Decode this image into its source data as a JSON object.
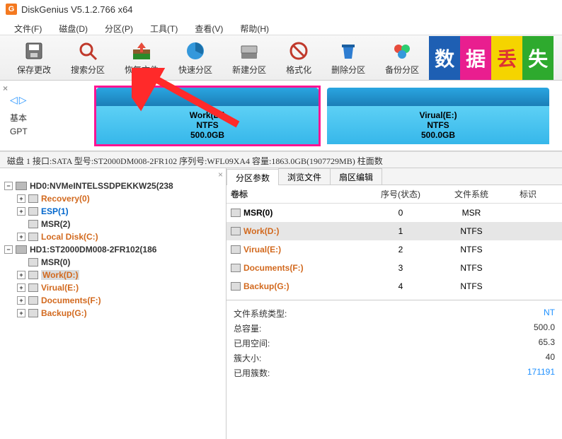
{
  "title": "DiskGenius V5.1.2.766 x64",
  "menu": [
    "文件(F)",
    "磁盘(D)",
    "分区(P)",
    "工具(T)",
    "查看(V)",
    "帮助(H)"
  ],
  "toolbar": [
    {
      "label": "保存更改",
      "icon": "save-icon"
    },
    {
      "label": "搜索分区",
      "icon": "search-icon"
    },
    {
      "label": "恢复文件",
      "icon": "recover-icon"
    },
    {
      "label": "快速分区",
      "icon": "quick-part-icon"
    },
    {
      "label": "新建分区",
      "icon": "new-part-icon"
    },
    {
      "label": "格式化",
      "icon": "format-icon"
    },
    {
      "label": "删除分区",
      "icon": "delete-part-icon"
    },
    {
      "label": "备份分区",
      "icon": "backup-icon"
    }
  ],
  "logo_chars": [
    {
      "ch": "数",
      "bg": "#1e5fb3"
    },
    {
      "ch": "据",
      "bg": "#e91e8f"
    },
    {
      "ch": "丢",
      "bg": "#f5d400",
      "fg": "#d33"
    },
    {
      "ch": "失",
      "bg": "#2eaa2e"
    }
  ],
  "left_box": {
    "l1": "基本",
    "l2": "GPT"
  },
  "volumes": [
    {
      "name": "Work(D:)",
      "fs": "NTFS",
      "size": "500.0GB",
      "selected": true
    },
    {
      "name": "Virual(E:)",
      "fs": "NTFS",
      "size": "500.0GB",
      "selected": false
    }
  ],
  "status": "磁盘 1  接口:SATA   型号:ST2000DM008-2FR102   序列号:WFL09XA4   容量:1863.0GB(1907729MB)   柱面数",
  "tree": {
    "d0": {
      "label": "HD0:NVMeINTELSSDPEKKW25(238",
      "children": [
        {
          "label": "Recovery(0)",
          "color": "orange"
        },
        {
          "label": "ESP(1)",
          "color": "blue"
        },
        {
          "label": "MSR(2)",
          "color": ""
        },
        {
          "label": "Local Disk(C:)",
          "color": "orange"
        }
      ]
    },
    "d1": {
      "label": "HD1:ST2000DM008-2FR102(186",
      "children": [
        {
          "label": "MSR(0)",
          "color": ""
        },
        {
          "label": "Work(D:)",
          "color": "orange",
          "selected": true
        },
        {
          "label": "Virual(E:)",
          "color": "orange"
        },
        {
          "label": "Documents(F:)",
          "color": "orange"
        },
        {
          "label": "Backup(G:)",
          "color": "orange"
        }
      ]
    }
  },
  "tabs": [
    "分区参数",
    "浏览文件",
    "扇区编辑"
  ],
  "table": {
    "headers": [
      "卷标",
      "序号(状态)",
      "文件系统",
      "标识"
    ],
    "rows": [
      {
        "name": "MSR(0)",
        "idx": "0",
        "fs": "MSR",
        "color": ""
      },
      {
        "name": "Work(D:)",
        "idx": "1",
        "fs": "NTFS",
        "color": "orange",
        "selected": true
      },
      {
        "name": "Virual(E:)",
        "idx": "2",
        "fs": "NTFS",
        "color": "orange"
      },
      {
        "name": "Documents(F:)",
        "idx": "3",
        "fs": "NTFS",
        "color": "orange"
      },
      {
        "name": "Backup(G:)",
        "idx": "4",
        "fs": "NTFS",
        "color": "orange"
      }
    ]
  },
  "info": [
    {
      "k": "文件系统类型:",
      "v": "NT",
      "blue": true
    },
    {
      "k": "总容量:",
      "v": "500.0"
    },
    {
      "k": "已用空间:",
      "v": "65.3"
    },
    {
      "k": "簇大小:",
      "v": "40"
    },
    {
      "k": "已用簇数:",
      "v": "171191"
    }
  ]
}
